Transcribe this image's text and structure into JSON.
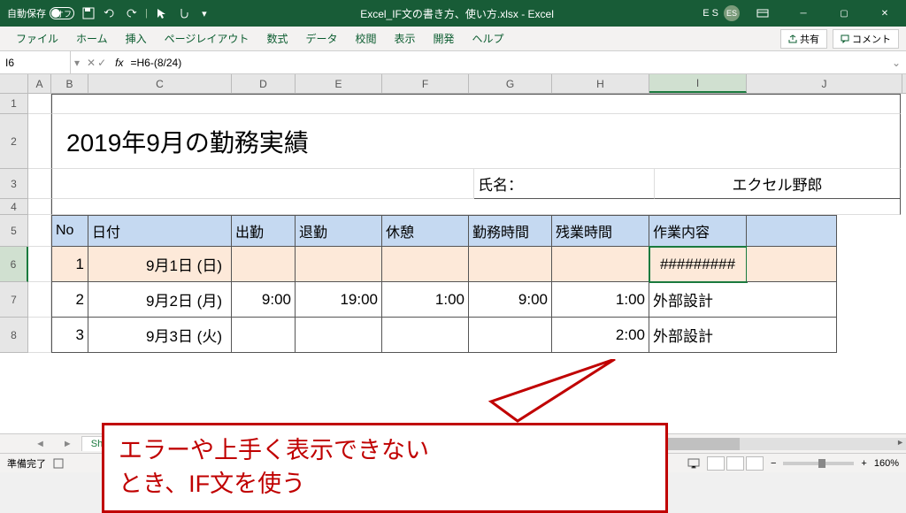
{
  "titlebar": {
    "autosave_label": "自動保存",
    "autosave_state": "オフ",
    "filename": "Excel_IF文の書き方、使い方.xlsx - Excel",
    "user_initials": "ES",
    "user_text": "E S"
  },
  "ribbon": {
    "tabs": [
      "ファイル",
      "ホーム",
      "挿入",
      "ページレイアウト",
      "数式",
      "データ",
      "校閲",
      "表示",
      "開発",
      "ヘルプ"
    ],
    "share": "共有",
    "comment": "コメント"
  },
  "formula_bar": {
    "cell_ref": "I6",
    "fx": "fx",
    "formula": "=H6-(8/24)"
  },
  "columns": [
    "A",
    "B",
    "C",
    "D",
    "E",
    "F",
    "G",
    "H",
    "I",
    "J"
  ],
  "row_nums": [
    "1",
    "2",
    "3",
    "4",
    "5",
    "6",
    "7",
    "8"
  ],
  "content": {
    "title": "2019年9月の勤務実績",
    "name_label": "氏名：",
    "name_value": "エクセル野郎",
    "headers": {
      "no": "No",
      "date": "日付",
      "in": "出勤",
      "out": "退勤",
      "break": "休憩",
      "work": "勤務時間",
      "ot": "残業時間",
      "task": "作業内容"
    },
    "rows": [
      {
        "no": "1",
        "date": "9月1日 (日)",
        "in": "",
        "out": "",
        "break": "",
        "work": "",
        "ot": "#########",
        "task": ""
      },
      {
        "no": "2",
        "date": "9月2日 (月)",
        "in": "9:00",
        "out": "19:00",
        "break": "1:00",
        "work": "9:00",
        "ot": "1:00",
        "task": "外部設計"
      },
      {
        "no": "3",
        "date": "9月3日 (火)",
        "in": "",
        "out": "",
        "break": "",
        "work": "",
        "ot": "2:00",
        "task": "外部設計"
      }
    ]
  },
  "callout": {
    "line1": "エラーや上手く表示できない",
    "line2": "とき、IF文を使う"
  },
  "sheet_tabs": {
    "active_partial": "Sh"
  },
  "statusbar": {
    "ready": "準備完了",
    "zoom": "160%"
  }
}
